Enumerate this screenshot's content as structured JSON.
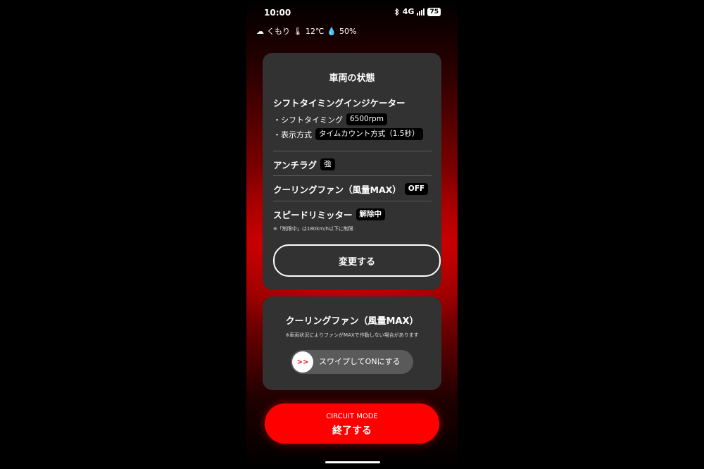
{
  "status_bar": {
    "time": "10:00",
    "network": "4G",
    "battery": "75"
  },
  "weather": {
    "condition": "くもり",
    "temperature": "12℃",
    "humidity": "50%"
  },
  "vehicle_card": {
    "title": "車両の状態",
    "shift_indicator": {
      "title": "シフトタイミングインジケーター",
      "rows": [
        {
          "label": "・シフトタイミング",
          "value": "6500rpm"
        },
        {
          "label": "・表示方式",
          "value": "タイムカウント方式（1.5秒）"
        }
      ]
    },
    "anti_lag": {
      "label": "アンチラグ",
      "value": "強"
    },
    "cooling_fan": {
      "label": "クーリングファン（風量MAX）",
      "value": "OFF"
    },
    "speed_limiter": {
      "label": "スピードリミッター",
      "value": "解除中",
      "note": "※「制限中」は180km/h以下に制限"
    },
    "change_button": "変更する"
  },
  "cooling_card": {
    "title": "クーリングファン（風量MAX）",
    "note": "※車両状況によりファンがMAXで作動しない場合があります",
    "swipe_label": "スワイプしてONにする",
    "knob_symbol": ">>"
  },
  "circuit_button": {
    "line1": "CIRCUIT MODE",
    "line2": "終了する"
  },
  "colors": {
    "accent": "#ff0000",
    "card": "#323232",
    "pill": "#000000"
  }
}
